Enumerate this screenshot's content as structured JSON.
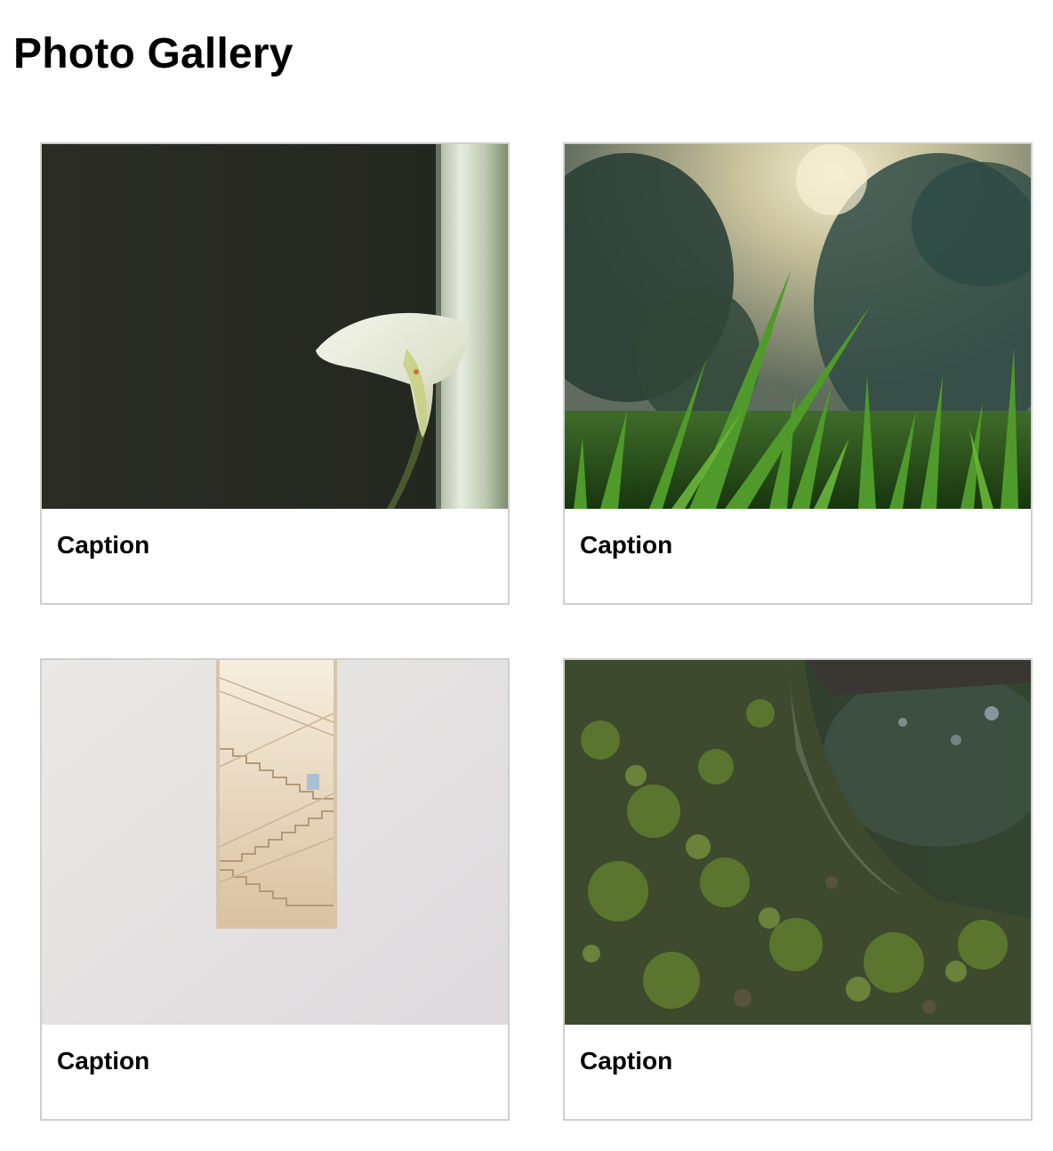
{
  "page": {
    "title": "Photo Gallery"
  },
  "gallery": {
    "items": [
      {
        "caption": "Caption",
        "photo_subject": "calla lily against dark wall"
      },
      {
        "caption": "Caption",
        "photo_subject": "grass blades with trees and sun"
      },
      {
        "caption": "Caption",
        "photo_subject": "staircase through narrow window"
      },
      {
        "caption": "Caption",
        "photo_subject": "moss covered tree trunk"
      }
    ]
  },
  "colors": {
    "card_border": "#cfcfcf",
    "background": "#ffffff",
    "text": "#000000"
  }
}
